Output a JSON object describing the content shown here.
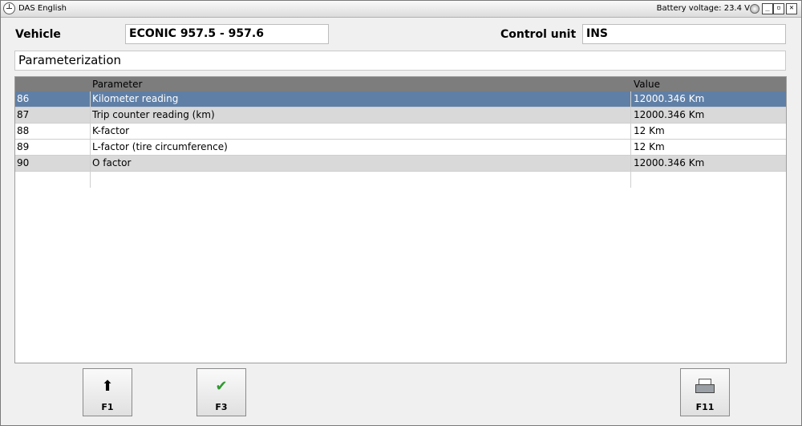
{
  "window": {
    "title": "DAS English",
    "battery_label": "Battery voltage: 23.4 V",
    "controls": {
      "minimize": "_",
      "restore": "▫",
      "close": "✕"
    }
  },
  "header": {
    "vehicle_label": "Vehicle",
    "vehicle_value": "ECONIC  957.5 - 957.6",
    "control_unit_label": "Control unit",
    "control_unit_value": "INS"
  },
  "section": {
    "title": "Parameterization"
  },
  "table": {
    "columns": [
      "",
      "Parameter",
      "Value"
    ],
    "rows": [
      {
        "id": "86",
        "parameter": "Kilometer reading",
        "value": "12000.346 Km",
        "selected": true
      },
      {
        "id": "87",
        "parameter": "Trip counter reading (km)",
        "value": "12000.346 Km",
        "selected": false
      },
      {
        "id": "88",
        "parameter": "K-factor",
        "value": "12 Km",
        "selected": false
      },
      {
        "id": "89",
        "parameter": "L-factor (tire circumference)",
        "value": "12 Km",
        "selected": false
      },
      {
        "id": "90",
        "parameter": "O factor",
        "value": "12000.346 Km",
        "selected": false
      }
    ]
  },
  "buttons": [
    {
      "key": "F1",
      "icon": "arrow-up-icon"
    },
    {
      "key": "F3",
      "icon": "checkmark-icon"
    },
    {
      "key": "F11",
      "icon": "printer-icon"
    }
  ],
  "colors": {
    "selected_row": "#5f7fa6",
    "alt_row": "#d9d9d9",
    "header_bar": "#7d7d7d",
    "check_green": "#2f9a2f"
  }
}
